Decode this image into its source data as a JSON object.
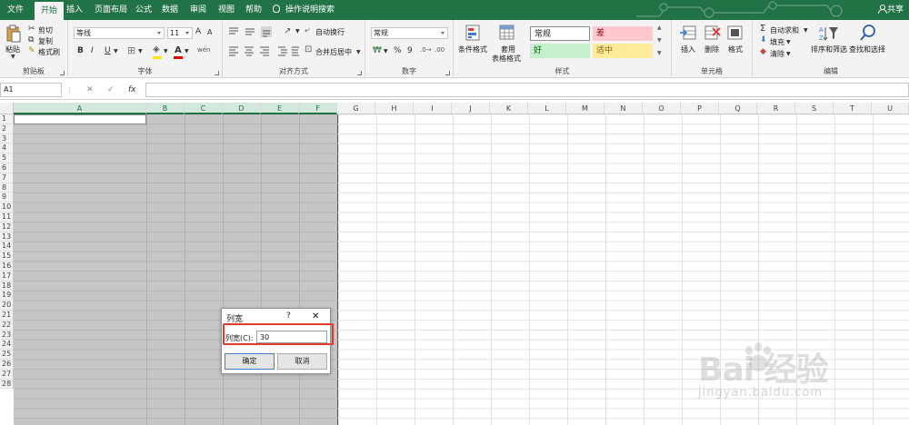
{
  "tabs": [
    {
      "label": "文件",
      "active": false
    },
    {
      "label": "开始",
      "active": true
    },
    {
      "label": "插入",
      "active": false
    },
    {
      "label": "页面布局",
      "active": false
    },
    {
      "label": "公式",
      "active": false
    },
    {
      "label": "数据",
      "active": false
    },
    {
      "label": "审阅",
      "active": false
    },
    {
      "label": "视图",
      "active": false
    },
    {
      "label": "帮助",
      "active": false
    }
  ],
  "tell_me": "操作说明搜索",
  "share": "共享",
  "ribbon": {
    "clipboard": {
      "paste": "粘贴",
      "cut": "剪切",
      "copy": "复制",
      "format_painter": "格式刷",
      "label": "剪贴板"
    },
    "font": {
      "family": "等线",
      "size": "11",
      "grow": "A",
      "shrink": "A",
      "bold": "B",
      "italic": "I",
      "underline": "U",
      "font_color_glyph": "A",
      "phonetic": "wén",
      "label": "字体"
    },
    "alignment": {
      "wrap_text": "自动换行",
      "merge_center": "合并后居中",
      "label": "对齐方式"
    },
    "number": {
      "format": "常规",
      "percent": "%",
      "comma": "9",
      "label": "数字"
    },
    "styles": {
      "conditional": "条件格式",
      "table_line1": "套用",
      "table_line2": "表格格式",
      "normal": "常规",
      "bad": "差",
      "good": "好",
      "neutral": "适中",
      "label": "样式"
    },
    "cells": {
      "insert": "插入",
      "delete": "删除",
      "format": "格式",
      "label": "单元格"
    },
    "editing": {
      "autosum": "自动求和",
      "fill": "填充",
      "clear": "清除",
      "sort_filter": "排序和筛选",
      "find_select": "查找和选择",
      "label": "编辑"
    }
  },
  "formula_bar": {
    "name_box": "A1",
    "cancel": "✕",
    "enter": "✓",
    "fx": "fx",
    "value": ""
  },
  "grid": {
    "columns": [
      "A",
      "B",
      "C",
      "D",
      "E",
      "F",
      "G",
      "H",
      "I",
      "J",
      "K",
      "L",
      "M",
      "N",
      "O",
      "P",
      "Q",
      "R",
      "S",
      "T",
      "U"
    ],
    "rows": [
      "1",
      "2",
      "3",
      "4",
      "5",
      "6",
      "7",
      "8",
      "9",
      "10",
      "11",
      "12",
      "13",
      "14",
      "15",
      "16",
      "17",
      "18",
      "19",
      "20",
      "21",
      "22",
      "23",
      "24",
      "25",
      "26",
      "27",
      "28"
    ],
    "selected_columns": [
      "A",
      "B",
      "C",
      "D",
      "E",
      "F"
    ]
  },
  "dialog": {
    "title": "列宽",
    "help": "?",
    "close": "✕",
    "field_label": "列宽(C):",
    "field_value": "30",
    "ok": "确定",
    "cancel": "取消"
  },
  "watermark": {
    "main": "Bai 经验",
    "sub": "jingyan.baidu.com"
  },
  "colors": {
    "accent": "#217346",
    "highlight": "#e23b2e",
    "selection": "#c6c6c6",
    "bad_fill": "#ffc7ce",
    "good_fill": "#c6efce",
    "neutral_fill": "#ffeb9c"
  }
}
